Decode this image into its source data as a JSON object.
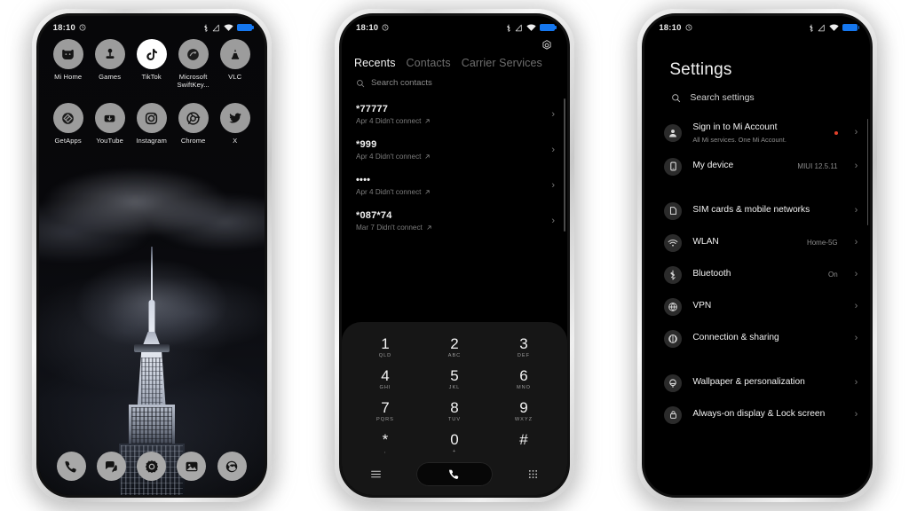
{
  "page": {
    "background": "#ffffff",
    "accent": "#1577ef",
    "badge_color": "#e2402a"
  },
  "status_bar": {
    "time": "18:10",
    "icons": [
      "alarm-icon",
      "bluetooth-icon",
      "signal-icon",
      "wifi-icon",
      "battery-icon"
    ]
  },
  "phone1": {
    "name": "home-screen",
    "wallpaper": "empire-state-building-in-fog-night",
    "app_rows": [
      [
        {
          "label": "Mi Home",
          "icon": "mi-home-icon",
          "style": "grey"
        },
        {
          "label": "Games",
          "icon": "games-joystick-icon",
          "style": "grey"
        },
        {
          "label": "TikTok",
          "icon": "tiktok-icon",
          "style": "white"
        },
        {
          "label": "Microsoft SwiftKey...",
          "icon": "microsoft-swiftkey-icon",
          "style": "grey"
        },
        {
          "label": "VLC",
          "icon": "vlc-cone-icon",
          "style": "grey"
        }
      ],
      [
        {
          "label": "GetApps",
          "icon": "getapps-icon",
          "style": "grey"
        },
        {
          "label": "YouTube",
          "icon": "youtube-icon",
          "style": "grey"
        },
        {
          "label": "Instagram",
          "icon": "instagram-icon",
          "style": "grey"
        },
        {
          "label": "Chrome",
          "icon": "chrome-icon",
          "style": "grey"
        },
        {
          "label": "X",
          "icon": "x-twitter-icon",
          "style": "grey"
        }
      ]
    ],
    "dock": [
      {
        "icon": "phone-icon",
        "name": "dock-phone"
      },
      {
        "icon": "messages-icon",
        "name": "dock-messages"
      },
      {
        "icon": "settings-gear-icon",
        "name": "dock-settings"
      },
      {
        "icon": "gallery-icon",
        "name": "dock-gallery"
      },
      {
        "icon": "camera-icon",
        "name": "dock-camera"
      }
    ]
  },
  "phone2": {
    "name": "dialer-recents",
    "settings_icon": "gear-icon",
    "tabs": [
      {
        "label": "Recents",
        "active": true
      },
      {
        "label": "Contacts",
        "active": false
      },
      {
        "label": "Carrier Services",
        "active": false
      }
    ],
    "search_placeholder": "Search contacts",
    "calls": [
      {
        "number": "*77777",
        "detail": "Apr 4 Didn't connect",
        "direction": "outgoing"
      },
      {
        "number": "*999",
        "detail": "Apr 4 Didn't connect",
        "direction": "outgoing"
      },
      {
        "number": "••••",
        "detail": "Apr 4 Didn't connect",
        "direction": "outgoing"
      },
      {
        "number": "*087*74",
        "detail": "Mar 7 Didn't connect",
        "direction": "outgoing"
      }
    ],
    "keypad": [
      [
        {
          "digit": "1",
          "sub": "QLD"
        },
        {
          "digit": "2",
          "sub": "ABC"
        },
        {
          "digit": "3",
          "sub": "DEF"
        }
      ],
      [
        {
          "digit": "4",
          "sub": "GHI"
        },
        {
          "digit": "5",
          "sub": "JKL"
        },
        {
          "digit": "6",
          "sub": "MNO"
        }
      ],
      [
        {
          "digit": "7",
          "sub": "PQRS"
        },
        {
          "digit": "8",
          "sub": "TUV"
        },
        {
          "digit": "9",
          "sub": "WXYZ"
        }
      ],
      [
        {
          "digit": "*",
          "sub": ","
        },
        {
          "digit": "0",
          "sub": "+"
        },
        {
          "digit": "#",
          "sub": ""
        }
      ]
    ],
    "bottom_bar": {
      "menu_icon": "hamburger-menu-icon",
      "call_icon": "phone-call-icon",
      "keypad_icon": "dialpad-grid-icon"
    }
  },
  "phone3": {
    "name": "settings-screen",
    "title": "Settings",
    "search_placeholder": "Search settings",
    "groups": [
      {
        "items": [
          {
            "label": "Sign in to Mi Account",
            "sub": "All Mi services. One Mi Account.",
            "value": "",
            "icon": "person-account-icon",
            "badge": true
          },
          {
            "label": "My device",
            "sub": "",
            "value": "MIUI 12.5.11",
            "icon": "device-phone-icon",
            "badge": false
          }
        ]
      },
      {
        "items": [
          {
            "label": "SIM cards & mobile networks",
            "sub": "",
            "value": "",
            "icon": "sim-card-icon",
            "badge": false
          },
          {
            "label": "WLAN",
            "sub": "",
            "value": "Home-5G",
            "icon": "wifi-icon",
            "badge": false
          },
          {
            "label": "Bluetooth",
            "sub": "",
            "value": "On",
            "icon": "bluetooth-icon",
            "badge": false
          },
          {
            "label": "VPN",
            "sub": "",
            "value": "",
            "icon": "globe-vpn-icon",
            "badge": false
          },
          {
            "label": "Connection & sharing",
            "sub": "",
            "value": "",
            "icon": "connection-sharing-icon",
            "badge": false
          }
        ]
      },
      {
        "items": [
          {
            "label": "Wallpaper & personalization",
            "sub": "",
            "value": "",
            "icon": "wallpaper-icon",
            "badge": false
          },
          {
            "label": "Always-on display & Lock screen",
            "sub": "",
            "value": "",
            "icon": "lock-icon",
            "badge": false
          }
        ]
      }
    ]
  }
}
